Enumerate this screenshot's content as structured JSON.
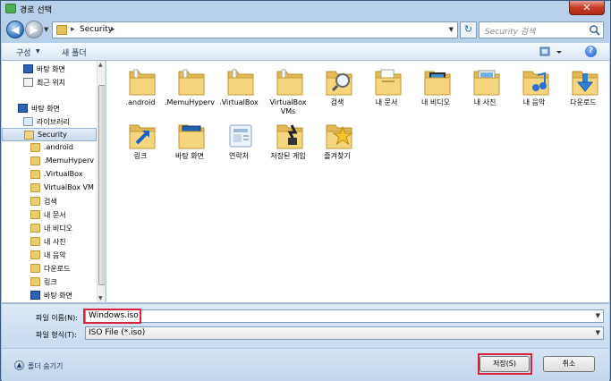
{
  "window": {
    "title": "경로 선택",
    "close_label": "✕"
  },
  "address": {
    "path_item": "Security",
    "search_placeholder": "Security 검색"
  },
  "toolbar": {
    "organize": "구성",
    "new_folder": "새 폴더",
    "help": "?"
  },
  "nav": {
    "items": [
      {
        "label": "바탕 화면",
        "icon": "desktop-icon"
      },
      {
        "label": "최근 위치",
        "icon": "recent-places-icon"
      },
      {
        "label": "바탕 화면",
        "icon": "desktop-icon"
      },
      {
        "label": "라이브러리",
        "icon": "library-icon"
      },
      {
        "label": "Security",
        "icon": "user-folder-icon",
        "selected": true
      },
      {
        "label": ".android",
        "icon": "folder-icon"
      },
      {
        "label": ".MemuHyperv",
        "icon": "folder-icon"
      },
      {
        "label": ".VirtualBox",
        "icon": "folder-icon"
      },
      {
        "label": "VirtualBox VM",
        "icon": "folder-icon"
      },
      {
        "label": "검색",
        "icon": "search-folder-icon"
      },
      {
        "label": "내 문서",
        "icon": "documents-icon"
      },
      {
        "label": "내 비디오",
        "icon": "videos-icon"
      },
      {
        "label": "내 사진",
        "icon": "pictures-icon"
      },
      {
        "label": "내 음악",
        "icon": "music-icon"
      },
      {
        "label": "다운로드",
        "icon": "downloads-icon"
      },
      {
        "label": "링크",
        "icon": "links-icon"
      },
      {
        "label": "바탕 화면",
        "icon": "desktop-icon"
      }
    ]
  },
  "files": [
    {
      "label": ".android",
      "icon": "folder-icon"
    },
    {
      "label": ".MemuHyperv",
      "icon": "folder-icon"
    },
    {
      "label": ".VirtualBox",
      "icon": "folder-icon"
    },
    {
      "label": "VirtualBox VMs",
      "icon": "folder-icon"
    },
    {
      "label": "검색",
      "icon": "search-folder-icon"
    },
    {
      "label": "내 문서",
      "icon": "documents-icon"
    },
    {
      "label": "내 비디오",
      "icon": "videos-icon"
    },
    {
      "label": "내 사진",
      "icon": "pictures-icon"
    },
    {
      "label": "내 음악",
      "icon": "music-icon"
    },
    {
      "label": "다운로드",
      "icon": "downloads-icon"
    },
    {
      "label": "링크",
      "icon": "links-icon"
    },
    {
      "label": "바탕 화면",
      "icon": "desktop-icon"
    },
    {
      "label": "연락처",
      "icon": "contacts-icon"
    },
    {
      "label": "저장된 게임",
      "icon": "saved-games-icon"
    },
    {
      "label": "즐겨찾기",
      "icon": "favorites-icon"
    }
  ],
  "form": {
    "filename_label": "파일 이름(N):",
    "filename_value": "Windows.iso",
    "filetype_label": "파일 형식(T):",
    "filetype_value": "ISO File (*.iso)"
  },
  "footer": {
    "hide_folders": "폴더 숨기기",
    "save": "저장(S)",
    "cancel": "취소"
  },
  "colors": {
    "highlight": "#d9233b",
    "folder": "#eacb6d"
  }
}
